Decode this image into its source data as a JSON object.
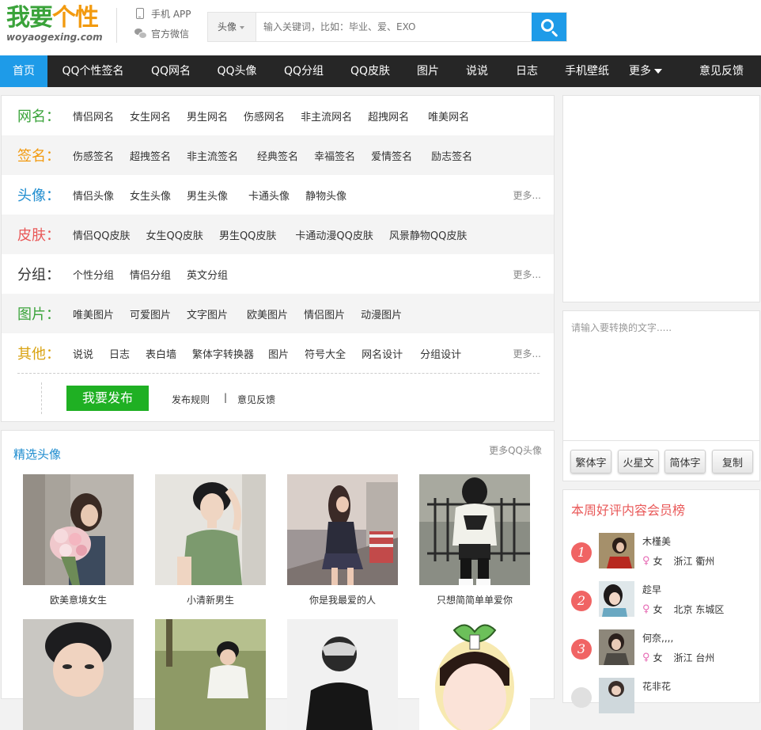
{
  "header": {
    "logo_main_1": "我要",
    "logo_main_2": "个性",
    "logo_sub": "woyaogexing.com",
    "quick_links": [
      "手机 APP",
      "官方微信"
    ],
    "search_type": "头像",
    "search_placeholder": "输入关键词，比如：毕业、爱、EXO"
  },
  "nav": {
    "items": [
      "首页",
      "QQ个性签名",
      "QQ网名",
      "QQ头像",
      "QQ分组",
      "QQ皮肤",
      "图片",
      "说说",
      "日志",
      "手机壁纸",
      "更多",
      "意见反馈"
    ],
    "active_color": "#1e9be8"
  },
  "categories": [
    {
      "label": "网名：",
      "color": "#3aa33a",
      "links": [
        "情侣网名",
        "女生网名",
        "男生网名",
        "伤感网名",
        "非主流网名",
        "超拽网名",
        "唯美网名"
      ],
      "more": ""
    },
    {
      "label": "签名：",
      "color": "#f29a0f",
      "links": [
        "伤感签名",
        "超拽签名",
        "非主流签名",
        "经典签名",
        "幸福签名",
        "爱情签名",
        "励志签名"
      ],
      "more": ""
    },
    {
      "label": "头像：",
      "color": "#1e8ccf",
      "links": [
        "情侣头像",
        "女生头像",
        "男生头像",
        "卡通头像",
        "静物头像"
      ],
      "more": "更多..."
    },
    {
      "label": "皮肤：",
      "color": "#e95959",
      "links": [
        "情侣QQ皮肤",
        "女生QQ皮肤",
        "男生QQ皮肤",
        "卡通动漫QQ皮肤",
        "风景静物QQ皮肤"
      ],
      "more": ""
    },
    {
      "label": "分组：",
      "color": "#333333",
      "links": [
        "个性分组",
        "情侣分组",
        "英文分组"
      ],
      "more": "更多..."
    },
    {
      "label": "图片：",
      "color": "#3aa33a",
      "links": [
        "唯美图片",
        "可爱图片",
        "文字图片",
        "欧美图片",
        "情侣图片",
        "动漫图片"
      ],
      "more": ""
    },
    {
      "label": "其他：",
      "color": "#d9a20f",
      "links": [
        "说说",
        "日志",
        "表白墙",
        "繁体字转换器",
        "图片",
        "符号大全",
        "网名设计",
        "分组设计"
      ],
      "more": "更多..."
    }
  ],
  "publish": {
    "button": "我要发布",
    "rules": "发布规则",
    "sep": "|",
    "feedback": "意见反馈"
  },
  "featured": {
    "title": "精选头像",
    "more": "更多QQ头像",
    "captions": [
      "欧美意境女生",
      "小清新男生",
      "你是我最爱的人",
      "只想简简单单爱你"
    ]
  },
  "converter": {
    "placeholder": "请输入要转换的文字.....",
    "buttons": [
      "繁体字",
      "火星文",
      "简体字",
      "复制"
    ]
  },
  "ranking": {
    "title": "本周好评内容会员榜",
    "members": [
      {
        "rank": "1",
        "name": "木槿美",
        "gender": "女",
        "location": "浙江 衢州"
      },
      {
        "rank": "2",
        "name": "趁早",
        "gender": "女",
        "location": "北京 东城区"
      },
      {
        "rank": "3",
        "name": "何奈,,,,",
        "gender": "女",
        "location": "浙江 台州"
      },
      {
        "rank": "",
        "name": "花非花",
        "gender": "",
        "location": ""
      }
    ]
  }
}
